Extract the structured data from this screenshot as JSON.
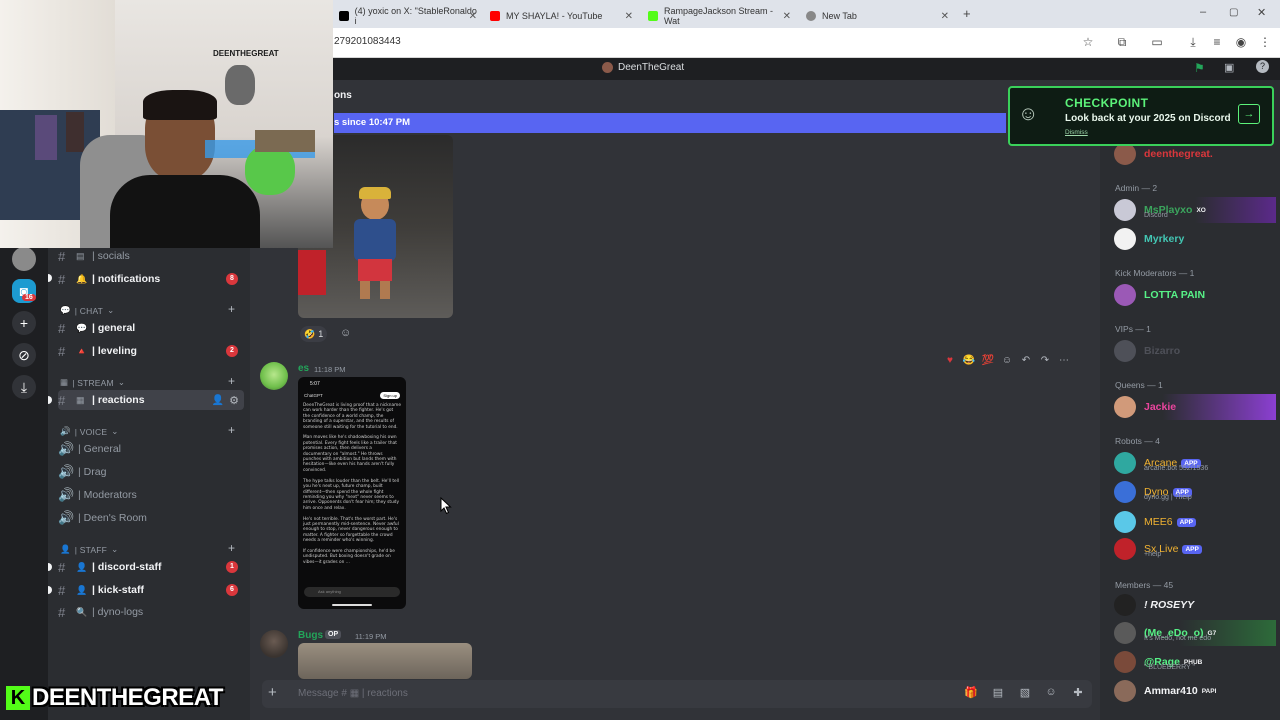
{
  "browser": {
    "tabs": [
      {
        "title": "(4) yoxic on X: \"StableRonaldo i",
        "color": "#000000"
      },
      {
        "title": "MY SHAYLA! - YouTube",
        "color": "#ff0000"
      },
      {
        "title": "RampageJackson Stream - Wat",
        "color": "#53fc18"
      },
      {
        "title": "New Tab",
        "color": "#888888"
      }
    ],
    "new_tab": "+",
    "url": "279201083443",
    "window_controls": [
      "–",
      "▢",
      "✕"
    ]
  },
  "server": {
    "name": "DeenTheGreat"
  },
  "rail": {
    "badge": "16"
  },
  "channels": {
    "items": [
      {
        "label": "| socials",
        "emoji": "▤"
      },
      {
        "label": "| notifications",
        "emoji": "🔔",
        "badge": "8"
      },
      {
        "label": "| general",
        "emoji": "💬"
      },
      {
        "label": "| leveling",
        "emoji": "🔺",
        "badge": "2"
      },
      {
        "label": "| reactions",
        "emoji": "▦"
      },
      {
        "label": "| General"
      },
      {
        "label": "| Drag"
      },
      {
        "label": "| Moderators"
      },
      {
        "label": "| Deen's Room"
      },
      {
        "label": "| discord-staff",
        "emoji": "👤",
        "badge": "1"
      },
      {
        "label": "| kick-staff",
        "emoji": "👤",
        "badge": "6"
      },
      {
        "label": "| dyno-logs",
        "emoji": "🔍"
      }
    ],
    "categories": [
      "| CHAT",
      "| STREAM",
      "| VOICE",
      "| STAFF"
    ]
  },
  "chat": {
    "header": "ons",
    "new_messages": "s since 10:47 PM",
    "reaction_count": "1",
    "msg1": {
      "author": "es",
      "time": "11:18 PM",
      "author_color": "#23a55a"
    },
    "msg2": {
      "author": "Bugs",
      "tag": "OP",
      "time": "11:19 PM",
      "author_color": "#23a55a"
    },
    "composer_placeholder": "Message # ▦ | reactions"
  },
  "phone": {
    "time": "5:07",
    "app": "ChatGPT",
    "signup": "Sign up",
    "body": "DeenTheGreat is living proof that a nickname can work harder than the fighter. He's got the confidence of a world champ, the branding of a superstar, and the results of someone still waiting for the tutorial to end.\n\nMan moves like he's shadowboxing his own potential. Every fight feels like a trailer that promises action, then delivers a documentary on \"almost.\" He throws punches with ambition but lands them with hesitation—like even his hands aren't fully convinced.\n\nThe hype talks louder than the belt. He'll tell you he's next up, future champ, built different—then spend the whole fight reminding you why \"next\" never seems to arrive. Opponents don't fear him; they study him once and relax.\n\nHe's not terrible. That's the worst part. He's just permanently mid-sentence. Never awful enough to stop, never dangerous enough to matter. A fighter so forgettable the crowd needs a reminder who's winning.\n\nIf confidence were championships, he'd be undisputed. But boxing doesn't grade on vibes—it grades on ...",
    "ask": "Ask anything"
  },
  "checkpoint": {
    "title": "CHECKPOINT",
    "subtitle": "Look back at your 2025 on Discord",
    "dismiss": "Dismiss",
    "arrow": "→"
  },
  "members": {
    "top": {
      "name": "deenthegreat.",
      "color": "#da373c"
    },
    "roles": [
      "Admin — 2",
      "Kick Moderators — 1",
      "VIPs — 1",
      "Queens — 1",
      "Robots — 4",
      "Members — 45"
    ],
    "list": [
      {
        "name": "MsPlayxo",
        "color": "#3ba55d",
        "tag": "XO",
        "sub": "Discord"
      },
      {
        "name": "Myrkery",
        "color": "#43c7b4"
      },
      {
        "name": "LOTTA PAIN",
        "color": "#57f287"
      },
      {
        "name": "Bizarro",
        "color": "#4e5058"
      },
      {
        "name": "Jackie",
        "color": "#eb459e"
      },
      {
        "name": "Arcane",
        "color": "#f0b232",
        "app": "APP",
        "sub": "arcane.bot 552/1536"
      },
      {
        "name": "Dyno",
        "color": "#f0b232",
        "app": "APP",
        "sub": "dyno.gg | ?help"
      },
      {
        "name": "MEE6",
        "color": "#f0b232",
        "app": "APP"
      },
      {
        "name": "Sx Live",
        "color": "#f0b232",
        "app": "APP",
        "sub": "+help"
      },
      {
        "name": "! ROSEYY",
        "color": "#f2f3f5"
      },
      {
        "name": "(Me_eDo_o)",
        "color": "#57f287",
        "tag": "G7",
        "sub": "It's Medo, not me edo"
      },
      {
        "name": "@Rage",
        "color": "#57f287",
        "tag": "PHUB",
        "sub": "\" BLUEBERRY \""
      },
      {
        "name": "Ammar410",
        "color": "#f2f3f5",
        "tag": "PAPI"
      }
    ]
  },
  "overlay": {
    "k": "K",
    "name": "DEENTHEGREAT"
  },
  "webcam": {
    "sign": "DEENTHEGREAT"
  }
}
